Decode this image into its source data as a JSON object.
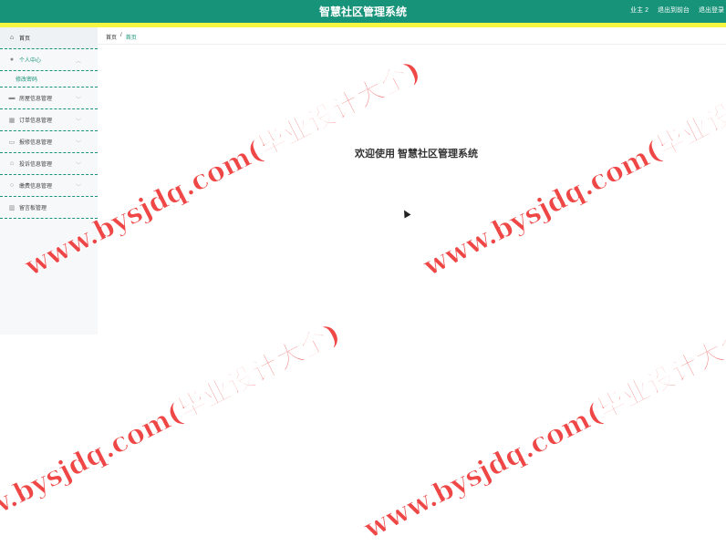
{
  "header": {
    "title": "智慧社区管理系统",
    "user": "业主 2",
    "to_front": "退出到前台",
    "logout": "退出登录"
  },
  "sidebar": {
    "items": [
      {
        "label": "首页",
        "icon": "home-icon",
        "active": true
      },
      {
        "label": "个人中心",
        "icon": "user-icon",
        "expanded": true,
        "children": [
          {
            "label": "修改密码"
          }
        ]
      },
      {
        "label": "房屋信息管理",
        "icon": "house-icon"
      },
      {
        "label": "订单信息管理",
        "icon": "grid-icon"
      },
      {
        "label": "报修信息管理",
        "icon": "chat-icon"
      },
      {
        "label": "投诉信息管理",
        "icon": "bank-icon"
      },
      {
        "label": "缴费信息管理",
        "icon": "clock-icon"
      },
      {
        "label": "留言板管理",
        "icon": "building-icon"
      }
    ]
  },
  "breadcrumb": {
    "home": "首页",
    "sep": "/",
    "current": "首页"
  },
  "main": {
    "welcome": "欢迎使用 智慧社区管理系统"
  },
  "watermark": {
    "text": "www.bysjdq.com(毕业设计大全)"
  },
  "colors": {
    "primary": "#169379",
    "accent_bar": "#f5f542",
    "watermark": "#ee3333"
  }
}
